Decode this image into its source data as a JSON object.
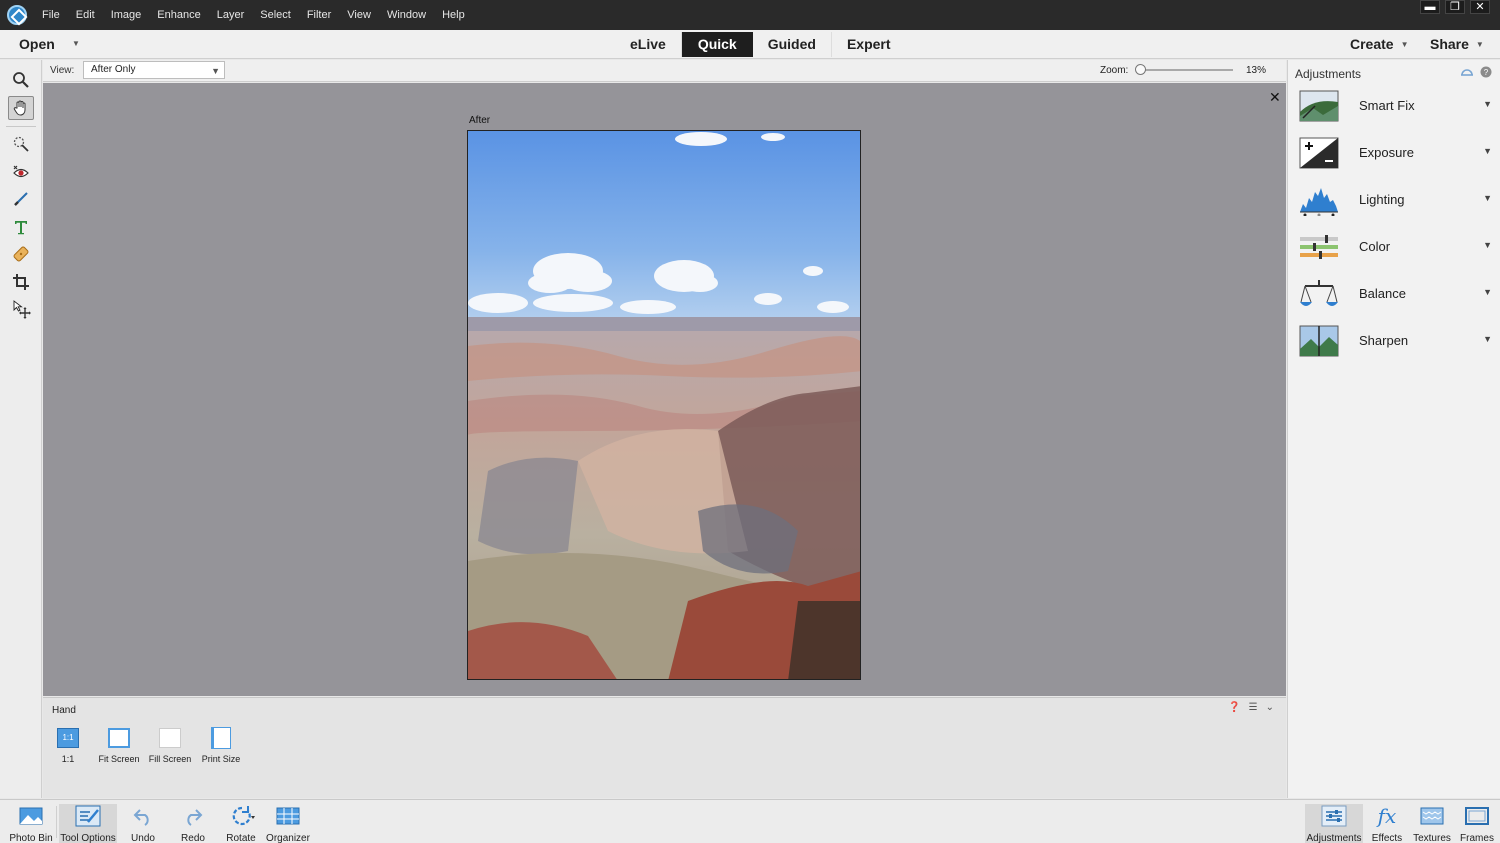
{
  "menubar": {
    "items": [
      "File",
      "Edit",
      "Image",
      "Enhance",
      "Layer",
      "Select",
      "Filter",
      "View",
      "Window",
      "Help"
    ],
    "window_controls": {
      "minimize": "▬",
      "restore": "❐",
      "close": "✕"
    }
  },
  "modebar": {
    "open_label": "Open",
    "tabs": [
      "eLive",
      "Quick",
      "Guided",
      "Expert"
    ],
    "active_tab": "Quick",
    "create_label": "Create",
    "share_label": "Share"
  },
  "viewbar": {
    "view_label": "View:",
    "view_value": "After Only",
    "zoom_label": "Zoom:",
    "zoom_value": "13%",
    "zoom_fraction": 0.0
  },
  "canvas": {
    "after_label": "After",
    "close_glyph": "✕"
  },
  "tool_options": {
    "tool_name": "Hand",
    "buttons": [
      "1:1",
      "Fit Screen",
      "Fill Screen",
      "Print Size"
    ],
    "icon_11_text": "1:1"
  },
  "adjustments": {
    "title": "Adjustments",
    "items": [
      "Smart Fix",
      "Exposure",
      "Lighting",
      "Color",
      "Balance",
      "Sharpen"
    ]
  },
  "bottombar": {
    "left": [
      "Photo Bin",
      "Tool Options",
      "Undo",
      "Redo",
      "Rotate",
      "Organizer"
    ],
    "right": [
      "Adjustments",
      "Effects",
      "Textures",
      "Frames"
    ],
    "effects_glyph": "fx"
  },
  "colors": {
    "accent": "#2f86c8",
    "canvas_bg": "#959499",
    "active_tab_bg": "#1e1e1e"
  }
}
